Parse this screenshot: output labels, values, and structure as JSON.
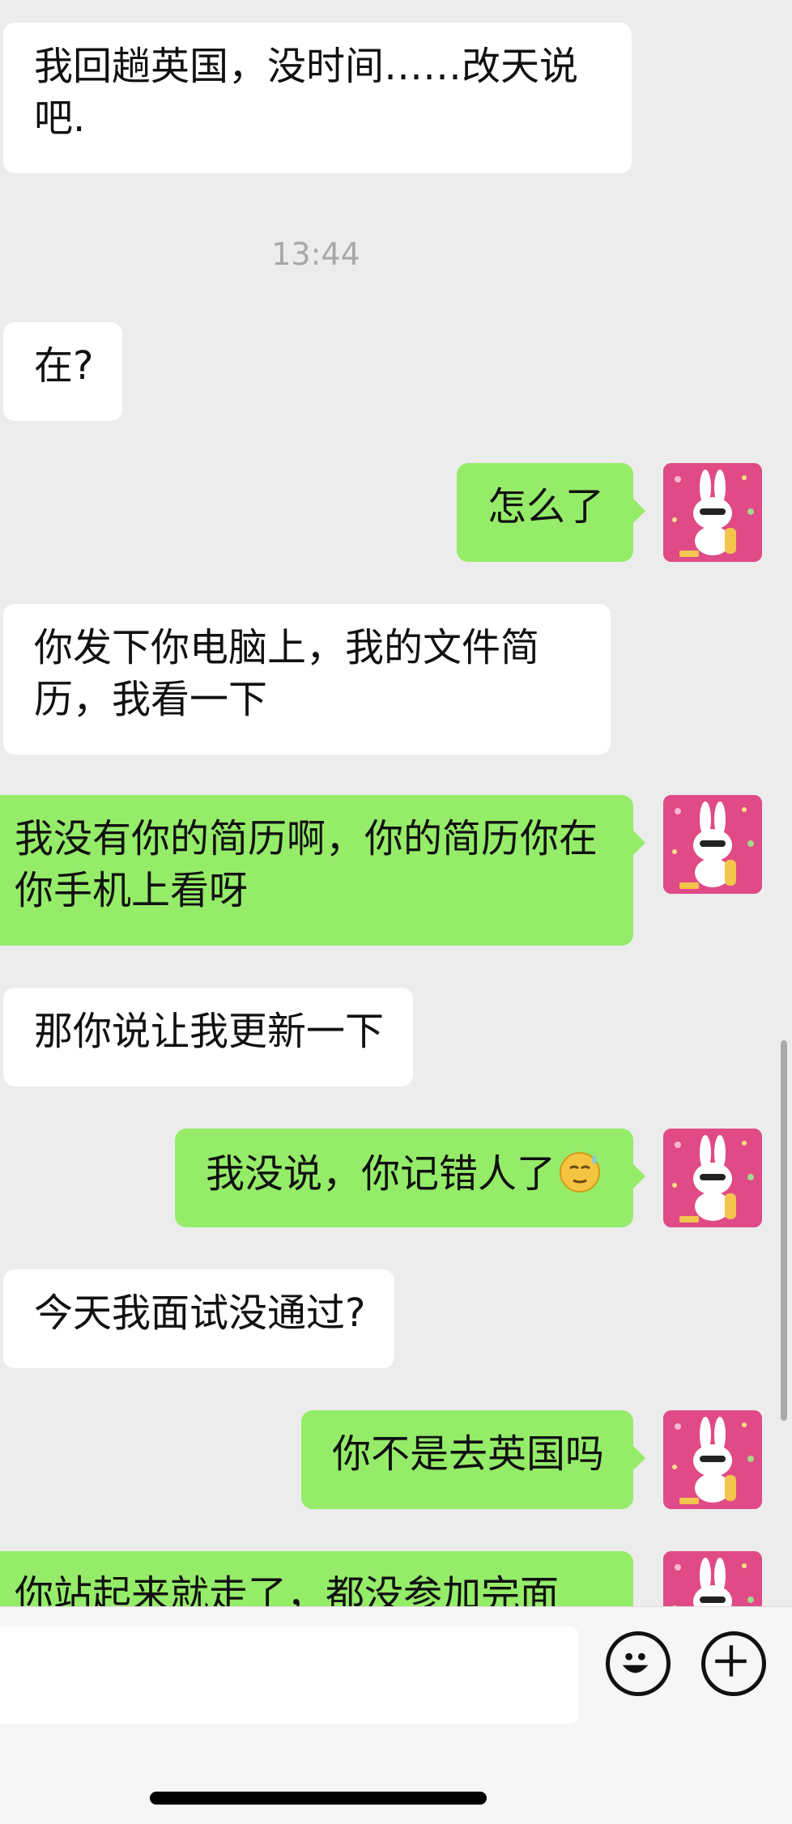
{
  "time_divider": "13:44",
  "messages": [
    {
      "side": "in",
      "text": "我回趟英国，没时间……改天说吧."
    },
    {
      "side": "in",
      "text": "在?"
    },
    {
      "side": "out",
      "text": "怎么了"
    },
    {
      "side": "in",
      "text": "你发下你电脑上，我的文件简历，我看一下"
    },
    {
      "side": "out",
      "text": "我没有你的简历啊，你的简历你在你手机上看呀"
    },
    {
      "side": "in",
      "text": "那你说让我更新一下"
    },
    {
      "side": "out",
      "text": "我没说，你记错人了",
      "emoji": "sweat-smile-emoji"
    },
    {
      "side": "in",
      "text": "今天我面试没通过?"
    },
    {
      "side": "out",
      "text": "你不是去英国吗"
    },
    {
      "side": "out",
      "text": "你站起来就走了，都没参加完面"
    }
  ],
  "input": {
    "placeholder": "",
    "value": ""
  },
  "icons": {
    "emoji_button": "smiley-icon",
    "plus_button": "plus-circle-icon",
    "avatar": "pink-bunny-avatar"
  },
  "colors": {
    "outgoing_bubble": "#95ec69",
    "incoming_bubble": "#ffffff",
    "background": "#ececec",
    "avatar_bg": "#e04a86"
  }
}
